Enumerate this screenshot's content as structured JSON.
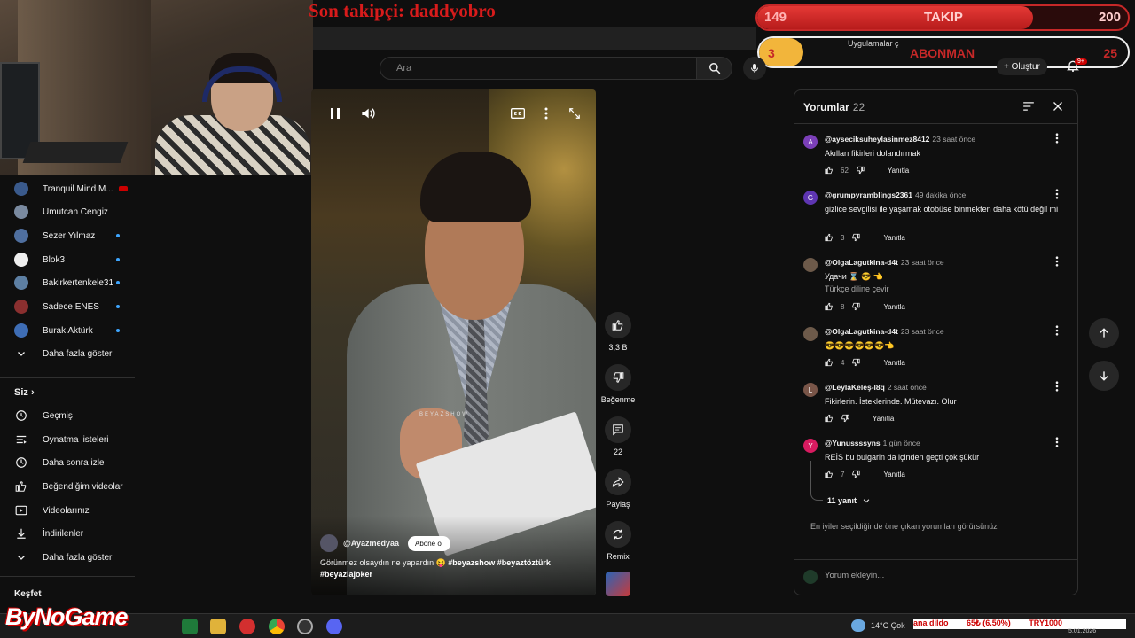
{
  "overlay": {
    "last_follower": "Son takipçi: daddyobro",
    "follow_bar": {
      "current": "149",
      "label": "TAKIP",
      "goal": "200",
      "progress": 0.745
    },
    "sub_bar": {
      "current": "3",
      "label": "ABONMAN",
      "goal": "25",
      "progress": 0.12,
      "bookmarks_text": "Uygulamalar ç"
    },
    "brand": "ByNoGame"
  },
  "header": {
    "search_placeholder": "Ara",
    "create_label": "Oluştur",
    "notification_count": "9+"
  },
  "sidebar": {
    "subscriptions": [
      {
        "label": "Tranquil Mind M...",
        "color": "#3a5a8c",
        "live": true
      },
      {
        "label": "Umutcan Cengiz",
        "color": "#7a8aa0",
        "dot": false
      },
      {
        "label": "Sezer Yılmaz",
        "color": "#4f6f9f",
        "dot": true
      },
      {
        "label": "Blok3",
        "color": "#eeeeee",
        "dot": true
      },
      {
        "label": "Bakirkertenkele31",
        "color": "#5d7fa3",
        "dot": true
      },
      {
        "label": "Sadece ENES",
        "color": "#8a2f2f",
        "dot": true
      },
      {
        "label": "Burak Aktürk",
        "color": "#3e6db5",
        "dot": true
      }
    ],
    "show_more": "Daha fazla göster",
    "you_header": "Siz",
    "you_items": [
      {
        "label": "Geçmiş",
        "icon": "history-icon"
      },
      {
        "label": "Oynatma listeleri",
        "icon": "playlists-icon"
      },
      {
        "label": "Daha sonra izle",
        "icon": "watch-later-icon"
      },
      {
        "label": "Beğendiğim videolar",
        "icon": "liked-videos-icon"
      },
      {
        "label": "Videolarınız",
        "icon": "your-videos-icon"
      },
      {
        "label": "İndirilenler",
        "icon": "downloads-icon"
      }
    ],
    "show_more_2": "Daha fazla göster",
    "explore_header": "Keşfet"
  },
  "video": {
    "channel": "@Ayazmedyaa",
    "subscribe_label": "Abone ol",
    "caption_text": "Görünmez olsaydın ne yapardın 😝 ",
    "caption_tags": "#beyazshow #beyaztöztürk #beyazlajoker",
    "watermark": "BEYAZSHOW"
  },
  "actions": {
    "likes": "3,3 B",
    "dislike_label": "Beğenme",
    "comments": "22",
    "share_label": "Paylaş",
    "remix_label": "Remix"
  },
  "comments": {
    "title": "Yorumlar",
    "count": "22",
    "reply_label": "Yanıtla",
    "items": [
      {
        "initial": "A",
        "avatar_color": "#7b3fb8",
        "user": "@ayseciksuheylasinmez8412",
        "time": "23 saat önce",
        "text": "Akılları fikirleri  dolandırmak",
        "likes": "62"
      },
      {
        "initial": "G",
        "avatar_color": "#5e35b1",
        "user": "@grumpyramblings2361",
        "time": "49 dakika önce",
        "text": "gizlice sevgilisi ile yaşamak otobüse binmekten daha kötü değil mi",
        "likes": "3"
      },
      {
        "initial": "",
        "avatar_color": "#6d5a4a",
        "user": "@OlgaLagutkina-d4t",
        "time": "23 saat önce",
        "text": "Удачи ⌛ 😎 👈",
        "translate": "Türkçe diline çevir",
        "likes": "8"
      },
      {
        "initial": "",
        "avatar_color": "#6d5a4a",
        "user": "@OlgaLagutkina-d4t",
        "time": "23 saat önce",
        "text": "😎😎😎😎😎😎👈",
        "likes": "4"
      },
      {
        "initial": "L",
        "avatar_color": "#795548",
        "user": "@LeylaKeleş-l8q",
        "time": "2 saat önce",
        "text": "Fikirlerin. İsteklerinde. Mütevazı.  Olur",
        "likes": ""
      },
      {
        "initial": "Y",
        "avatar_color": "#d81b60",
        "user": "@Yunussssyns",
        "time": "1 gün önce",
        "text": "REİS bu bulgarin da içinden geçti çok şükür",
        "likes": "7"
      }
    ],
    "replies_label": "11 yanıt",
    "footer_note": "En iyiler seçildiğinde öne çıkan yorumları görürsünüz",
    "input_placeholder": "Yorum ekleyin..."
  },
  "taskbar": {
    "weather": "14°C  Çok",
    "ticker": [
      "ana dildo",
      "65₺ (6.50%)",
      "TRY1000"
    ],
    "date": "5.01.2026"
  },
  "colors": {
    "accent_red": "#cc0000",
    "link_blue": "#3ea6ff",
    "bg": "#0f0f0f"
  }
}
